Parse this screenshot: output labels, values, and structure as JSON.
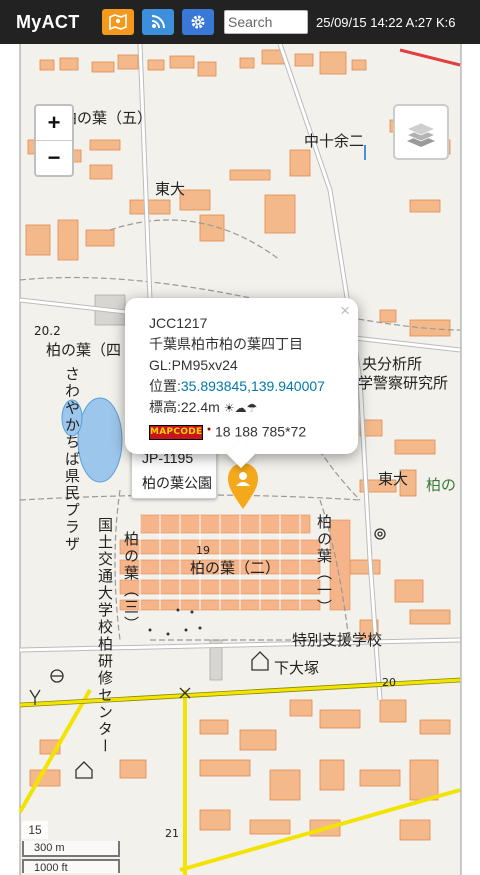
{
  "app": {
    "title": "MyACT"
  },
  "toolbar": {
    "buttons": [
      {
        "icon": "map-pin-icon",
        "color": "#f39a1e"
      },
      {
        "icon": "broadcast-icon",
        "color": "#3b8fdb"
      },
      {
        "icon": "gear-icon",
        "color": "#3a78d8"
      }
    ],
    "search_placeholder": "Search",
    "status": "25/09/15 14:22 A:27 K:6"
  },
  "map": {
    "labels": [
      {
        "text": "柏の葉（五）"
      },
      {
        "text": "中十余二"
      },
      {
        "text": "東大"
      },
      {
        "text": "柏の葉（四"
      },
      {
        "text": "央分析所"
      },
      {
        "text": "学警察研究所"
      },
      {
        "text": "東大"
      },
      {
        "text": "柏の"
      },
      {
        "text": "柏の葉（二）"
      },
      {
        "text": "特別支援学校"
      },
      {
        "text": "下大塚"
      },
      {
        "text": "20.2"
      },
      {
        "text": "20"
      },
      {
        "text": "19"
      },
      {
        "text": "21"
      }
    ],
    "vertical_labels": [
      {
        "text": "さわやかちば県民プラザ"
      },
      {
        "text": "国土交通大学校柏研修センター"
      },
      {
        "text": "柏の葉（三）"
      },
      {
        "text": "柏の葉（一）"
      }
    ],
    "zoom_in": "+",
    "zoom_out": "−",
    "zoom_level": "15",
    "scale_metric": "300 m",
    "scale_imperial": "1000 ft"
  },
  "popup": {
    "code": "JCC1217",
    "address": "千葉県柏市柏の葉四丁目",
    "grid": "GL:PM95xv24",
    "position_label": "位置:",
    "position_value": "35.893845,139.940007",
    "elevation": "標高:22.4m",
    "weather": "☀☁☂",
    "mapcode_logo": "MAPCODE",
    "mapcode": "18 188 785*72",
    "close": "×"
  },
  "tooltip": {
    "line1": "JP-1195",
    "line2": "柏の葉公園"
  },
  "marker": {
    "icon": "person-pin-icon",
    "color": "#f4a81c"
  }
}
